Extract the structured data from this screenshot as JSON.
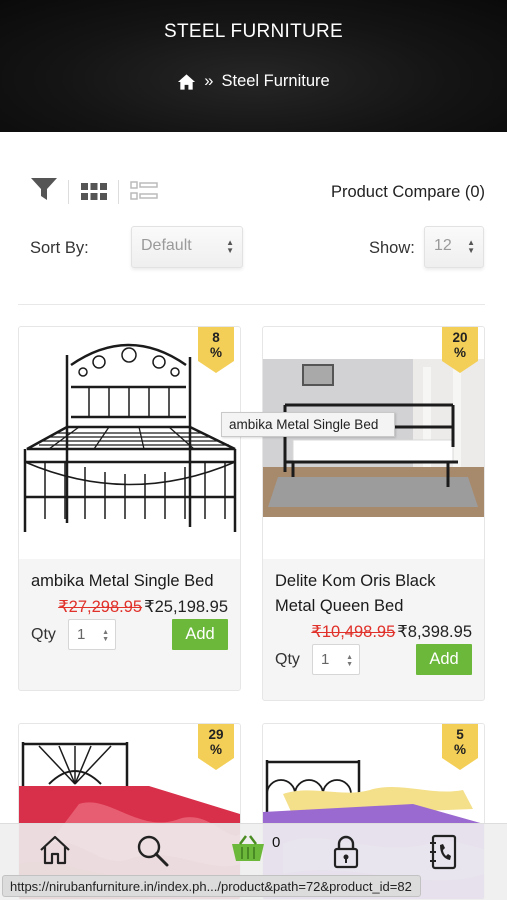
{
  "hero": {
    "title": "STEEL FURNITURE",
    "breadcrumb_separator": "»",
    "breadcrumb_current": "Steel Furniture"
  },
  "toolbar": {
    "compare_label": "Product Compare (0)"
  },
  "sort": {
    "label": "Sort By:",
    "value": "Default"
  },
  "show": {
    "label": "Show:",
    "value": "12"
  },
  "products": [
    {
      "discount": "8\n%",
      "name": "ambika Metal Single Bed",
      "old_price": "₹27,298.95",
      "price": "₹25,198.95",
      "qty_label": "Qty",
      "qty": "1",
      "add_label": "Add"
    },
    {
      "discount": "20\n%",
      "name": "Delite Kom Oris Black Metal Queen Bed",
      "old_price": "₹10,498.95",
      "price": "₹8,398.95",
      "qty_label": "Qty",
      "qty": "1",
      "add_label": "Add"
    },
    {
      "discount": "29\n%"
    },
    {
      "discount": "5\n%"
    }
  ],
  "tooltip": "ambika Metal Single Bed",
  "bottom_nav": {
    "cart_count": "0"
  },
  "status_url": "https://nirubanfurniture.in/index.ph.../product&path=72&product_id=82",
  "colors": {
    "accent_green": "#6cb83a",
    "badge_yellow": "#f4cf57",
    "old_price_red": "#e0312a"
  }
}
